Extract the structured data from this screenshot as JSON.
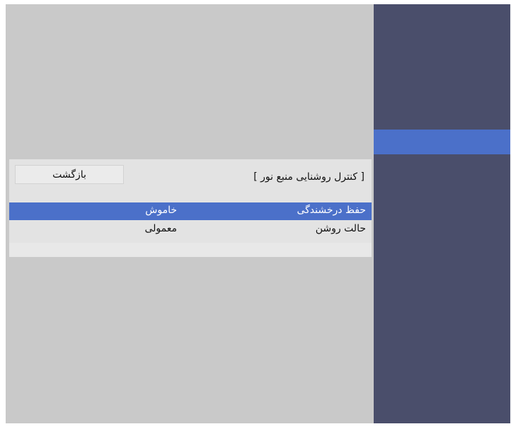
{
  "menu": {
    "title": "[ کنترل روشنایی منبع نور ]",
    "back_label": "بازگشت",
    "rows": [
      {
        "label": "حفظ درخشندگی",
        "value": "خاموش",
        "selected": true
      },
      {
        "label": "حالت روشن",
        "value": "معمولی",
        "selected": false
      }
    ]
  },
  "colors": {
    "background": "#c9c9c9",
    "right_panel": "#4a4e6b",
    "highlight": "#4b70c9",
    "menu_box": "#e3e3e3"
  }
}
